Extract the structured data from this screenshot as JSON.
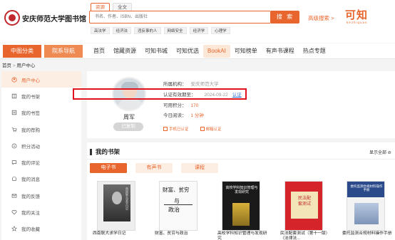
{
  "header": {
    "library_name": "安庆师范大学图书馆",
    "search_tabs": [
      "资源",
      "全文"
    ],
    "search_placeholder": "书名、作者、ISBN、出版社",
    "search_button": "搜 索",
    "advanced_search": "高级搜索 >",
    "brand": "可知",
    "brand_sub": "kezhiquan",
    "hot_tags": [
      "高法学",
      "经济法",
      "违反事的人",
      "网络安全",
      "经济学",
      "心理学"
    ]
  },
  "nav": {
    "left_tabs": [
      "中图分类",
      "院系导航"
    ],
    "links": [
      "首页",
      "馆藏资源",
      "可知书城",
      "可知优选",
      "BookAI",
      "可知榜单",
      "有声书课程",
      "热点专题"
    ],
    "active_link": "BookAI"
  },
  "breadcrumb": {
    "home": "首页",
    "sep": ">",
    "current": "用户中心"
  },
  "sidebar": {
    "items": [
      {
        "label": "用户中心",
        "icon": "user-icon",
        "active": true
      },
      {
        "label": "我的书架",
        "icon": "book-icon"
      },
      {
        "label": "我的书签",
        "icon": "bookmark-icon"
      },
      {
        "label": "我的荐购",
        "icon": "cart-icon"
      },
      {
        "label": "积分活动",
        "icon": "coin-icon"
      },
      {
        "label": "我的评论",
        "icon": "comment-icon"
      },
      {
        "label": "我的消息",
        "icon": "message-icon"
      },
      {
        "label": "我的反馈",
        "icon": "mail-icon"
      },
      {
        "label": "我的关注",
        "icon": "heart-icon"
      },
      {
        "label": "我的收藏",
        "icon": "star-icon"
      }
    ]
  },
  "profile": {
    "name": "周军",
    "status": "已复制",
    "institution_label": "所属机构：",
    "institution": "安庆师范大学",
    "expiry_label": "认证有效期至：",
    "expiry_date": "2024-09-22",
    "expiry_link": "认证",
    "points_label": "可用积分：",
    "points": "170",
    "reading_label": "今日阅读：",
    "reading": "1 分钟",
    "auth_links": [
      "手机已认证",
      "邮箱认证"
    ]
  },
  "shelf": {
    "title": "我的书架",
    "show_all": "显示全部 ⊘",
    "tabs": [
      "电子书",
      "有声书",
      "课程"
    ],
    "active_tab": "电子书",
    "books": [
      {
        "title": "西南联大求学日记",
        "cover_text": "西南联大求学日记"
      },
      {
        "title": "财富、贫穷与政治",
        "cover_lines": [
          "财富、贫穷",
          "与",
          "政治"
        ]
      },
      {
        "title": "高校学科知识管理与发现研究",
        "cover_text": "高校学科知识管理与发现研究"
      },
      {
        "title": "民法配套测试（第十一版）（法律法...",
        "cover_text": "民法配套测试"
      },
      {
        "title": "委托监测合规材料操作手册",
        "cover_text": "委托监测合规材料操作手册"
      }
    ]
  },
  "colors": {
    "accent": "#e8662e",
    "highlight": "#e0141e",
    "link": "#3b7ad9"
  }
}
